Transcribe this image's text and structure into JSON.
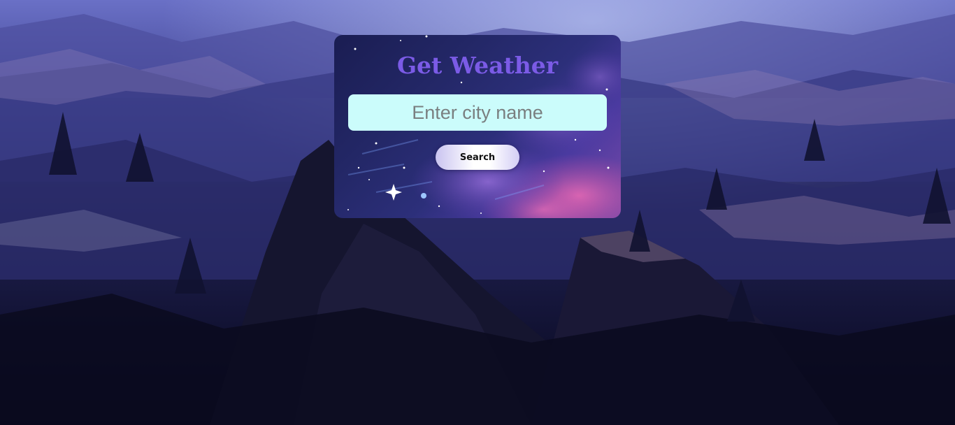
{
  "page": {
    "title": "Get Weather"
  },
  "search": {
    "placeholder": "Enter city name",
    "value": "",
    "button_label": "Search"
  },
  "colors": {
    "title": "#7b5be6",
    "input_background": "#cbfcfb",
    "card_background": "#232766"
  },
  "icons": {
    "card_decoration": "starry-night-art",
    "page_background": "mountain-landscape-art"
  }
}
